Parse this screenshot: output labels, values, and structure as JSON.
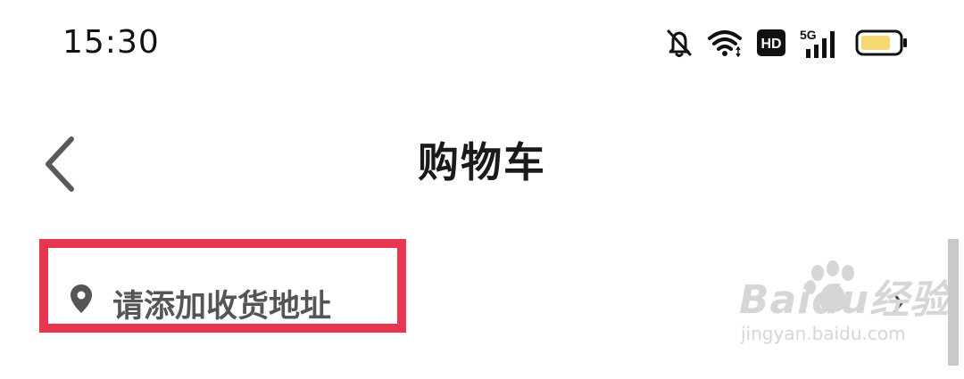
{
  "status_bar": {
    "time": "15:30",
    "icons": [
      "bell-off-icon",
      "wifi-icon",
      "hd-icon",
      "signal-5g-icon",
      "battery-icon"
    ],
    "hd_label": "HD",
    "network_label": "5G",
    "battery_color": "#f6d870"
  },
  "header": {
    "back_icon": "chevron-left-icon",
    "title": "购物车"
  },
  "address": {
    "icon": "location-pin-icon",
    "label": "请添加收货地址",
    "chevron_icon": "chevron-right-icon",
    "highlight_color": "#e8384f"
  },
  "watermark": {
    "brand_text": "Baidu经验",
    "url": "jingyan.baidu.com"
  }
}
